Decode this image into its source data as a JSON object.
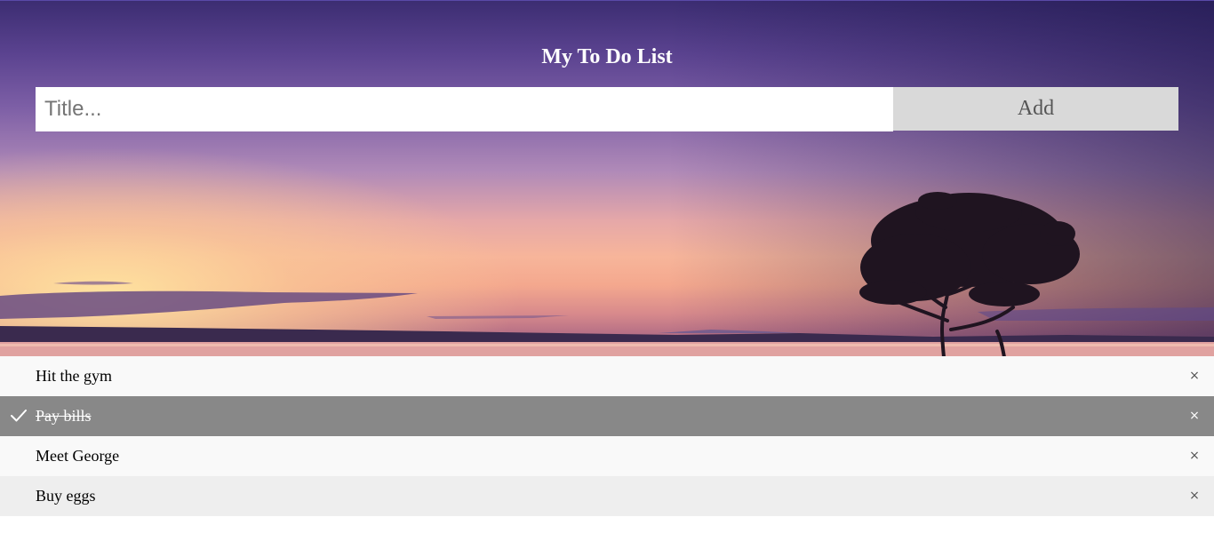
{
  "header": {
    "title": "My To Do List"
  },
  "form": {
    "placeholder": "Title...",
    "add_label": "Add"
  },
  "todos": [
    {
      "text": "Hit the gym",
      "checked": false,
      "close_label": "×"
    },
    {
      "text": "Pay bills",
      "checked": true,
      "close_label": "×"
    },
    {
      "text": "Meet George",
      "checked": false,
      "close_label": "×"
    },
    {
      "text": "Buy eggs",
      "checked": false,
      "close_label": "×"
    }
  ],
  "colors": {
    "checked_row": "#888888",
    "add_button": "#d9d9d9",
    "row_light": "#f9f9f9",
    "row_dark": "#eeeeee"
  },
  "icons": {
    "checked": "check-icon",
    "remove": "close-icon"
  }
}
